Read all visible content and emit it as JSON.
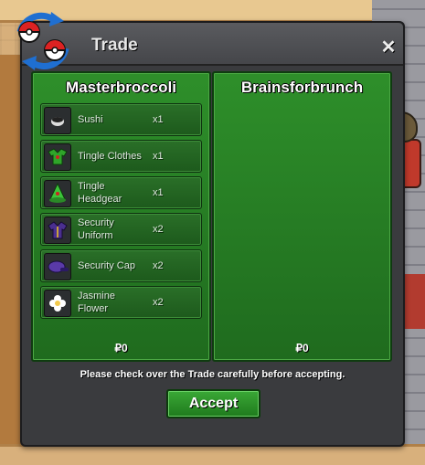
{
  "window": {
    "title": "Trade",
    "close_symbol": "✕"
  },
  "left_panel": {
    "player_name": "Masterbroccoli",
    "money": "₽0",
    "items": [
      {
        "name": "Sushi",
        "qty": "x1",
        "icon": "sushi-icon"
      },
      {
        "name": "Tingle Clothes",
        "qty": "x1",
        "icon": "clothes-icon"
      },
      {
        "name": "Tingle Headgear",
        "qty": "x1",
        "icon": "headgear-icon"
      },
      {
        "name": "Security Uniform",
        "qty": "x2",
        "icon": "uniform-icon"
      },
      {
        "name": "Security Cap",
        "qty": "x2",
        "icon": "cap-icon"
      },
      {
        "name": "Jasmine Flower",
        "qty": "x2",
        "icon": "flower-icon"
      }
    ]
  },
  "right_panel": {
    "player_name": "Brainsforbrunch",
    "money": "₽0",
    "items": []
  },
  "footer": {
    "notice": "Please check over the Trade carefully before accepting.",
    "accept_label": "Accept"
  }
}
